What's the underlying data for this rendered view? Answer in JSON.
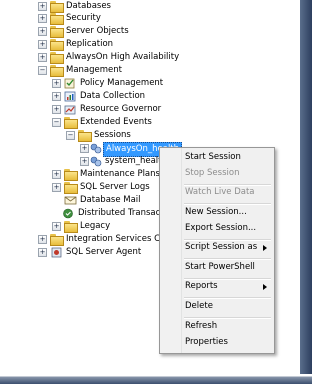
{
  "tree": {
    "databases": "Databases",
    "security": "Security",
    "server_objects": "Server Objects",
    "replication": "Replication",
    "alwayson": "AlwaysOn High Availability",
    "management": "Management",
    "policy_management": "Policy Management",
    "data_collection": "Data Collection",
    "resource_governor": "Resource Governor",
    "extended_events": "Extended Events",
    "sessions": "Sessions",
    "alwayson_health": "AlwaysOn_health",
    "system_health": "system_health",
    "maintenance_plans": "Maintenance Plans",
    "sql_server_logs": "SQL Server Logs",
    "database_mail": "Database Mail",
    "distributed_transactions": "Distributed Transactio",
    "legacy": "Legacy",
    "integration_services": "Integration Services Catal",
    "sql_server_agent": "SQL Server Agent"
  },
  "context_menu": {
    "start_session": "Start Session",
    "stop_session": "Stop Session",
    "watch_live_data": "Watch Live Data",
    "new_session": "New Session...",
    "export_session": "Export Session...",
    "script_session_as": "Script Session as",
    "start_powershell": "Start PowerShell",
    "reports": "Reports",
    "delete": "Delete",
    "refresh": "Refresh",
    "properties": "Properties"
  },
  "icons": {
    "expand_collapsed": "+",
    "expand_open": "−"
  },
  "colors": {
    "selection": "#3399ff",
    "folder": "#e7bd3c",
    "window_frame": "#2c3e5e",
    "menu_background": "#f0f0f0",
    "disabled_text": "#8d8d8d"
  }
}
